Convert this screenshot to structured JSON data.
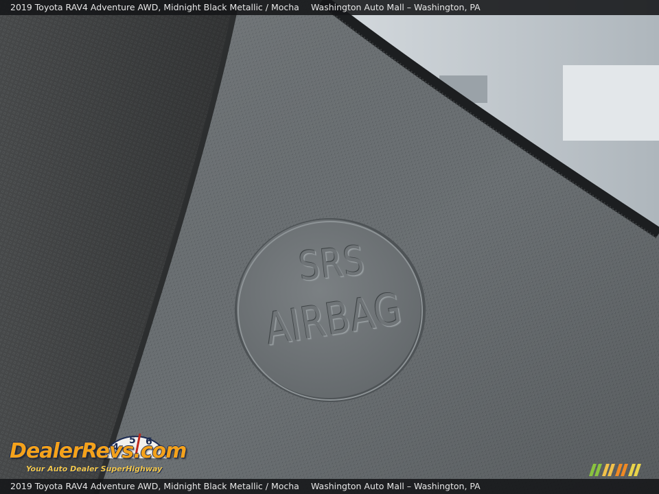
{
  "caption": {
    "vehicle": "2019 Toyota RAV4 Adventure AWD,  Midnight Black Metallic / Mocha",
    "dealer": "Washington Auto Mall – Washington, PA"
  },
  "airbag_label": {
    "line1": "SRS",
    "line2": "AIRBAG"
  },
  "watermark": {
    "brand": "DealerRevs.com",
    "tagline": "Your Auto Dealer SuperHighway",
    "gauge_digits": [
      "4",
      "5",
      "6"
    ]
  },
  "colors": {
    "seat_fabric": "#4a4c4d",
    "panel": "#6b7073",
    "trim_edge": "#1c1e20",
    "window": "#c9cfd3",
    "logo_orange": "#f4a21b",
    "logo_navy": "#1b2a52",
    "stripe_colors": [
      "#8ac33f",
      "#f2c14a",
      "#f08a24",
      "#e9d44a"
    ]
  }
}
